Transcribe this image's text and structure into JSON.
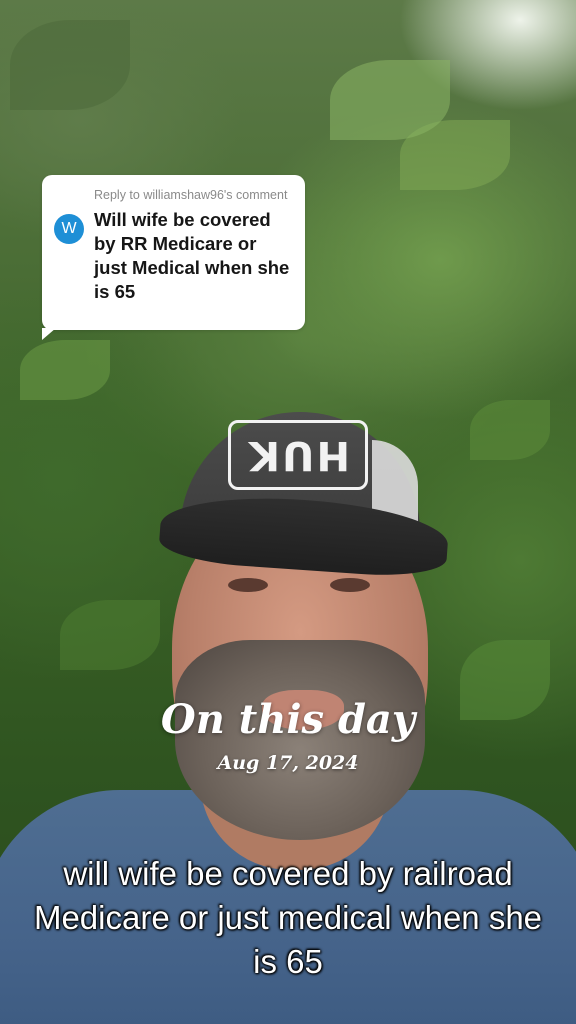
{
  "comment_card": {
    "reply_label": "Reply to williamshaw96's comment",
    "avatar_letter": "W",
    "comment_text": "Will wife be covered by RR Medicare or just Medical when she is 65",
    "avatar_color": "#1e8fd6"
  },
  "memory": {
    "title": "On this day",
    "date": "Aug 17, 2024"
  },
  "cap_logo": "HUK",
  "caption": {
    "text": "will wife be covered by railroad Medicare or just medical when she is 65"
  }
}
